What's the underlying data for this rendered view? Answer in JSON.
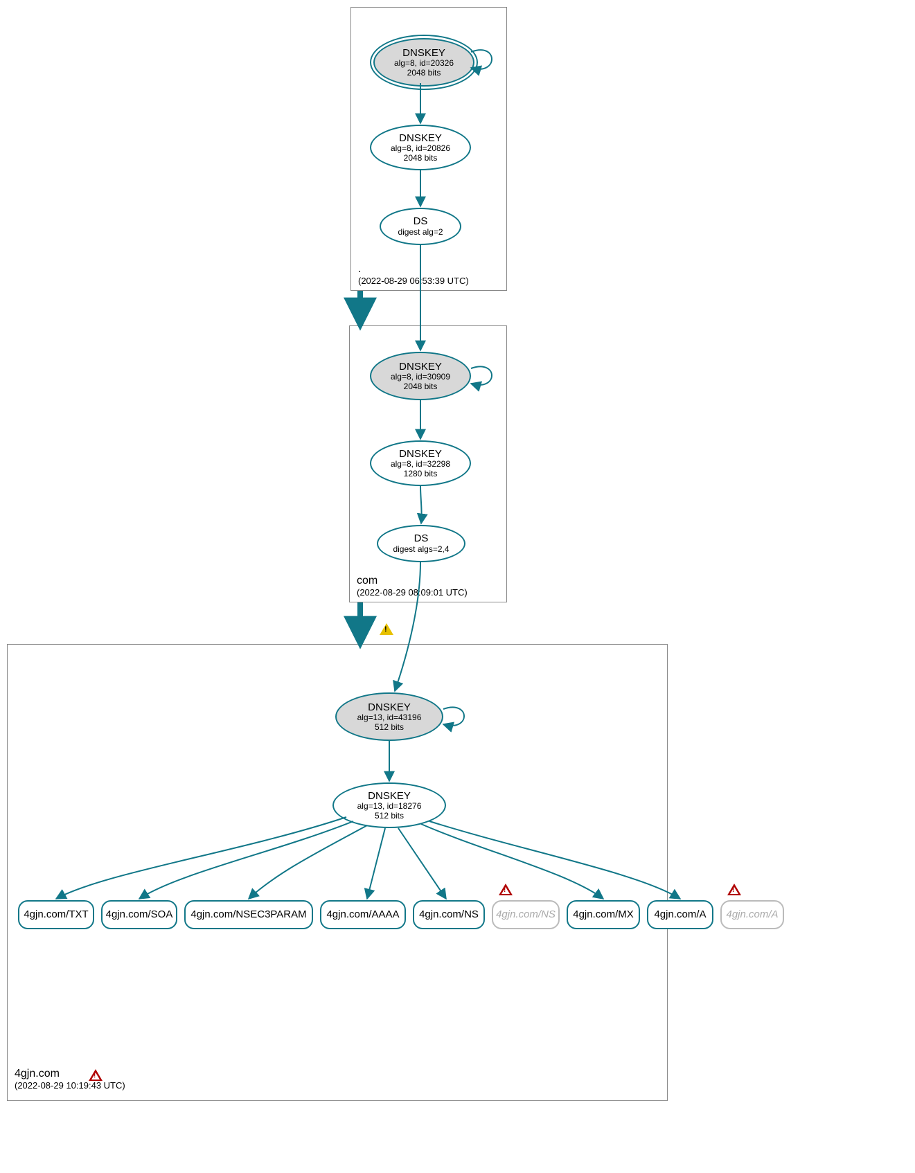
{
  "colors": {
    "edge": "#117788",
    "edge_thick": "#117788",
    "node_grey": "#d8d8d8"
  },
  "zones": {
    "root": {
      "name": ".",
      "timestamp": "(2022-08-29 06:53:39 UTC)",
      "nodes": {
        "ksk": {
          "title": "DNSKEY",
          "sub1": "alg=8, id=20326",
          "sub2": "2048 bits"
        },
        "zsk": {
          "title": "DNSKEY",
          "sub1": "alg=8, id=20826",
          "sub2": "2048 bits"
        },
        "ds": {
          "title": "DS",
          "sub1": "digest alg=2"
        }
      }
    },
    "com": {
      "name": "com",
      "timestamp": "(2022-08-29 08:09:01 UTC)",
      "nodes": {
        "ksk": {
          "title": "DNSKEY",
          "sub1": "alg=8, id=30909",
          "sub2": "2048 bits"
        },
        "zsk": {
          "title": "DNSKEY",
          "sub1": "alg=8, id=32298",
          "sub2": "1280 bits"
        },
        "ds": {
          "title": "DS",
          "sub1": "digest algs=2,4"
        }
      }
    },
    "leaf": {
      "name": "4gjn.com",
      "timestamp": "(2022-08-29 10:19:43 UTC)",
      "nodes": {
        "ksk": {
          "title": "DNSKEY",
          "sub1": "alg=13, id=43196",
          "sub2": "512 bits"
        },
        "zsk": {
          "title": "DNSKEY",
          "sub1": "alg=13, id=18276",
          "sub2": "512 bits"
        }
      },
      "rrsets": {
        "r0": "4gjn.com/TXT",
        "r1": "4gjn.com/SOA",
        "r2": "4gjn.com/NSEC3PARAM",
        "r3": "4gjn.com/AAAA",
        "r4": "4gjn.com/NS",
        "r5": "4gjn.com/NS",
        "r6": "4gjn.com/MX",
        "r7": "4gjn.com/A",
        "r8": "4gjn.com/A"
      }
    }
  }
}
